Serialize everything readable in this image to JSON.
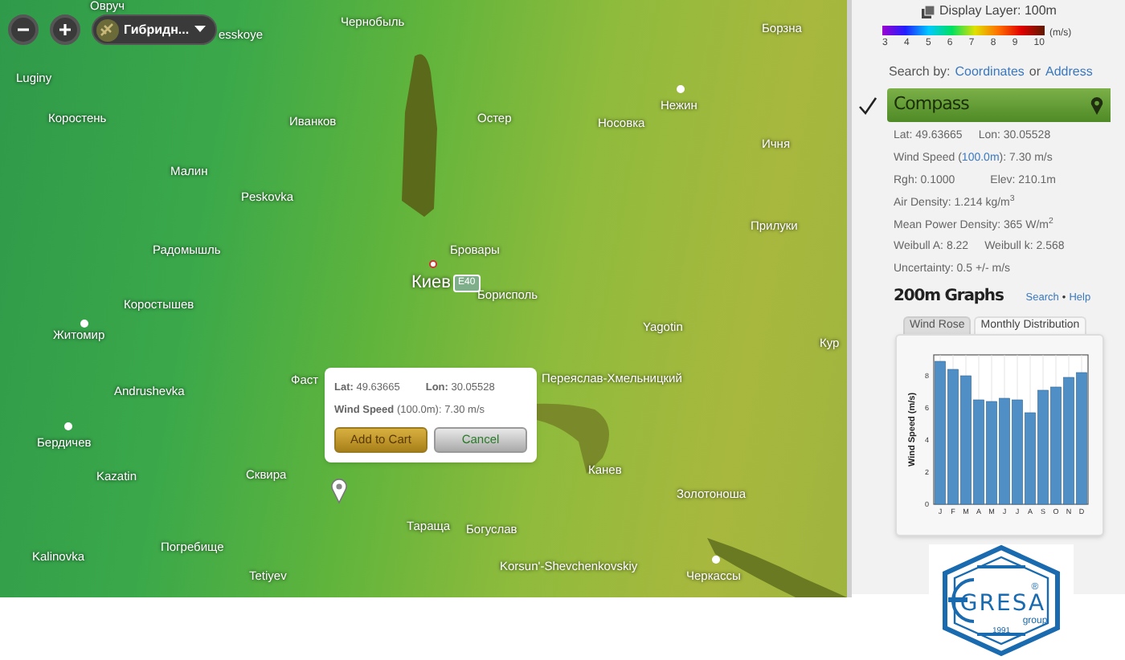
{
  "map": {
    "layer_dropdown": {
      "label": "Гибридн..."
    },
    "labels": [
      {
        "text": "Овруч"
      },
      {
        "text": "esskoye"
      },
      {
        "text": "Чернобыль"
      },
      {
        "text": "Борзна"
      },
      {
        "text": "Luginy"
      },
      {
        "text": "Коростень"
      },
      {
        "text": "Иванков"
      },
      {
        "text": "Остер"
      },
      {
        "text": "Носовка"
      },
      {
        "text": "Нежин"
      },
      {
        "text": "Ичня"
      },
      {
        "text": "Малин"
      },
      {
        "text": "Peskovka"
      },
      {
        "text": "Прилуки"
      },
      {
        "text": "Радомышль"
      },
      {
        "text": "Бровары"
      },
      {
        "text": "Киев",
        "kind": "capital"
      },
      {
        "text": "Борисполь"
      },
      {
        "text": "Коростышев"
      },
      {
        "text": "Житомир"
      },
      {
        "text": "Yagotin"
      },
      {
        "text": "Кур"
      },
      {
        "text": "Andrushevka"
      },
      {
        "text": "Фаст"
      },
      {
        "text": "Переяслав-Хмельницкий"
      },
      {
        "text": "Бердичев"
      },
      {
        "text": "Kazatin"
      },
      {
        "text": "Сквира"
      },
      {
        "text": "Канев"
      },
      {
        "text": "Золотоноша"
      },
      {
        "text": "Тараща"
      },
      {
        "text": "Богуслав"
      },
      {
        "text": "Погребище"
      },
      {
        "text": "Kalinovka"
      },
      {
        "text": "Tetiyev"
      },
      {
        "text": "Korsun'-Shevchenkovskiy"
      },
      {
        "text": "Черкассы"
      }
    ],
    "road_badge": "E40",
    "popup": {
      "lat": "**Lat:** 49.63665",
      "lon": "**Lon:** 30.05528",
      "wind": "**Wind Speed** (100.0m): 7.30 m/s",
      "buttons": [
        {
          "label": "Add to Cart",
          "kind": "primary"
        },
        {
          "label": "Cancel",
          "kind": "secondary"
        }
      ]
    }
  },
  "panel": {
    "display_layer": "Display Layer: 100m",
    "legend": {
      "ticks": [
        "3",
        "4",
        "5",
        "6",
        "7",
        "8",
        "9",
        "10"
      ],
      "unit": "(m/s)"
    },
    "search_by": {
      "label": "Search by:",
      "options": [
        "Coordinates",
        "Address"
      ],
      "joiner": "or"
    },
    "compass": {
      "label": "Compass",
      "checked": true
    },
    "info": [
      {
        "parts": [
          {
            "text": "Lat: 49.63665"
          },
          {
            "text": "Lon: 30.05528"
          }
        ]
      },
      {
        "parts": [
          {
            "text": "Wind Speed (",
            "kind": "plain"
          },
          {
            "text": "100.0m",
            "kind": "link"
          },
          {
            "text": "): 7.30 m/s",
            "kind": "plain"
          }
        ],
        "kind": "inline"
      },
      {
        "parts": [
          {
            "text": "Rgh: 0.1000"
          },
          {
            "text": "Elev: 210.1m"
          }
        ]
      },
      {
        "parts": [
          {
            "text": "Air Density: 1.214 kg/m$^{3}$"
          }
        ]
      },
      {
        "parts": [
          {
            "text": "Mean Power Density: 365 W/m$^{2}$"
          }
        ]
      },
      {
        "parts": [
          {
            "text": "Weibull A: 8.22"
          },
          {
            "text": "Weibull k: 2.568"
          }
        ]
      },
      {
        "parts": [
          {
            "text": "Uncertainty: 0.5 +/- m/s"
          }
        ]
      }
    ],
    "graphs": {
      "title": "200m Graphs",
      "links": [
        "Search",
        "Help"
      ],
      "separator": "•",
      "tabs": [
        {
          "label": "Wind Rose",
          "selected": false
        },
        {
          "label": "Monthly Distribution",
          "selected": true
        }
      ],
      "chart_data": {
        "type": "bar",
        "ylabel": "Wind Speed (m/s)",
        "categories": [
          "J",
          "F",
          "M",
          "A",
          "M",
          "J",
          "J",
          "A",
          "S",
          "O",
          "N",
          "D"
        ],
        "series": [
          {
            "color": "#4f8fc6",
            "values": [
              8.9,
              8.4,
              8.0,
              6.5,
              6.4,
              6.6,
              6.5,
              5.7,
              7.1,
              7.3,
              7.9,
              8.2
            ]
          }
        ],
        "ylim": [
          0,
          9.3
        ],
        "yticks": [
          0,
          2,
          4,
          6,
          8
        ],
        "grid": true
      }
    },
    "logo": {
      "name": "GRESA",
      "sub": "group",
      "year": "1991",
      "mark": "®"
    }
  }
}
